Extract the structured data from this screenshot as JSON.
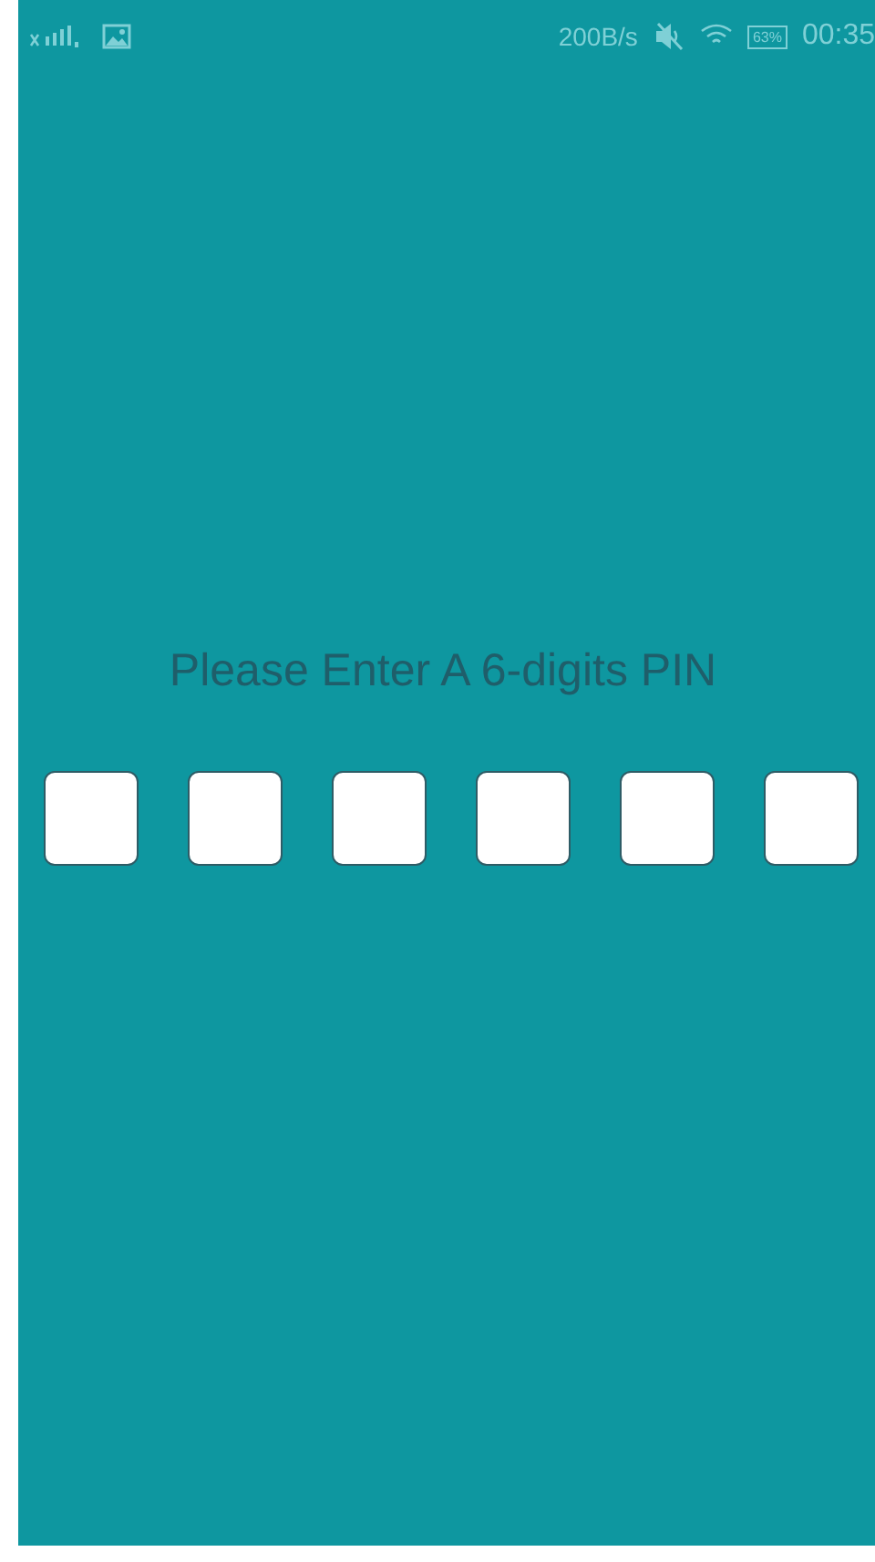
{
  "status_bar": {
    "network_speed": "200B/s",
    "battery": "63%",
    "time": "00:35"
  },
  "prompt": "Please Enter A 6-digits PIN",
  "pin_boxes": [
    {
      "filled": false
    },
    {
      "filled": false
    },
    {
      "filled": false
    },
    {
      "filled": false
    },
    {
      "filled": false
    },
    {
      "filled": false
    }
  ]
}
